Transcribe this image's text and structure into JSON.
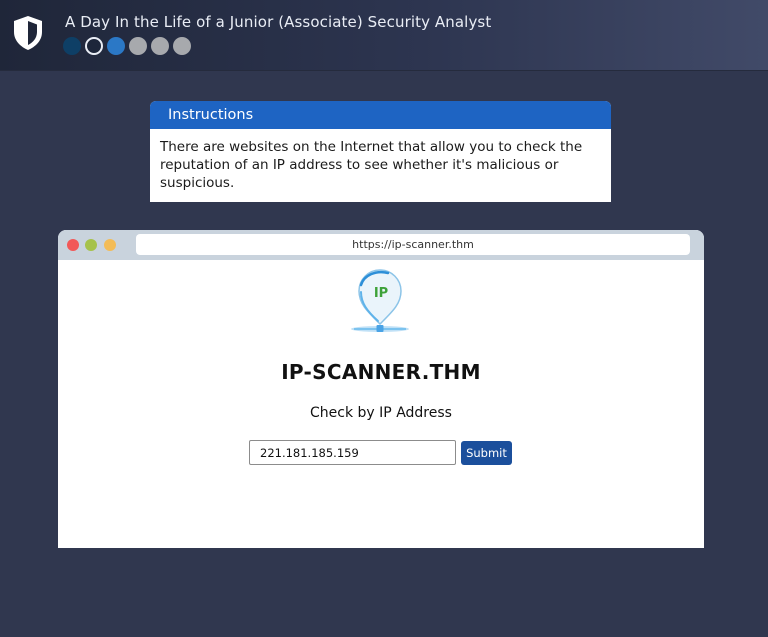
{
  "header": {
    "title": "A Day In the Life of a Junior (Associate) Security Analyst",
    "logo_icon": "shield-icon",
    "steps": [
      "done",
      "current",
      "active",
      "todo",
      "todo",
      "todo"
    ]
  },
  "instructions": {
    "title": "Instructions",
    "body": "There are websites on the Internet that allow you to check the reputation of an IP address to see whether it's malicious or suspicious."
  },
  "browser": {
    "url": "https://ip-scanner.thm",
    "logo_text": "IP",
    "site_title": "IP-SCANNER.THM",
    "subtitle": "Check by IP Address",
    "ip_value": "221.181.185.159",
    "submit_label": "Submit"
  },
  "colors": {
    "background": "#30374f",
    "accent": "#1e64c3",
    "submit": "#1b4f9c"
  }
}
